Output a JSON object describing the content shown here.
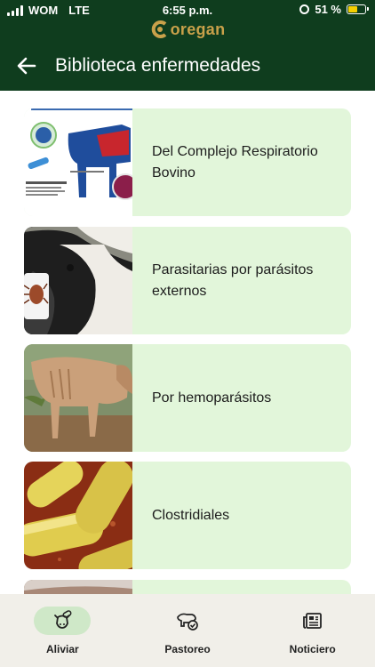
{
  "status_bar": {
    "carrier": "WOM",
    "network": "LTE",
    "time": "6:55 p.m.",
    "battery": "51 %"
  },
  "brand": {
    "logo_text": "oregan",
    "logo_color": "#c9a14a"
  },
  "header": {
    "title": "Biblioteca enfermedades",
    "back_icon": "arrow-left-icon",
    "background_color": "#0f3d1e"
  },
  "diseases": [
    {
      "label": "Del Complejo Respiratorio Bovino",
      "image": "respiratory-diagram-thumbnail"
    },
    {
      "label": "Parasitarias por parásitos externos",
      "image": "cow-with-tick-thumbnail"
    },
    {
      "label": "Por hemoparásitos",
      "image": "thin-cow-thumbnail"
    },
    {
      "label": "Clostridiales",
      "image": "bacteria-rods-thumbnail"
    },
    {
      "label": "",
      "image": "partial-thumbnail"
    }
  ],
  "card_color": "#e2f6da",
  "bottom_nav": [
    {
      "label": "Aliviar",
      "icon": "cow-pill-icon",
      "active": true
    },
    {
      "label": "Pastoreo",
      "icon": "cow-check-icon",
      "active": false
    },
    {
      "label": "Noticiero",
      "icon": "newspaper-icon",
      "active": false
    }
  ]
}
